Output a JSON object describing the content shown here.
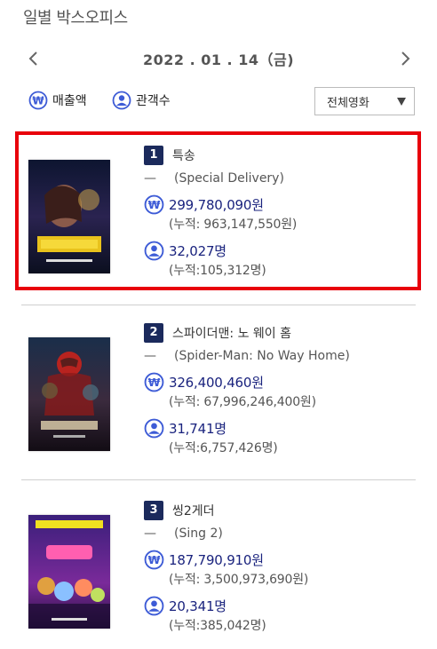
{
  "page": {
    "title": "일별 박스오피스"
  },
  "date_nav": {
    "date": "2022 . 01 . 14（금)",
    "prev_icon": "chevron-left-icon",
    "next_icon": "chevron-right-icon"
  },
  "toggles": {
    "sales_label": "매출액",
    "sales_icon": "won-icon",
    "audience_label": "관객수",
    "audience_icon": "person-icon"
  },
  "filter": {
    "selected": "전체영화"
  },
  "colors": {
    "accent": "#1b2a5c",
    "highlight": "#e8000b",
    "icon": "#3d5bd6"
  },
  "movies": [
    {
      "rank": "1",
      "title": "특송",
      "dash": "—",
      "original_title": "(Special Delivery)",
      "sales": "299,780,090원",
      "sales_cum": "(누적: 963,147,550원)",
      "audience": "32,027명",
      "audience_cum": "(누적:105,312명)",
      "highlighted": true
    },
    {
      "rank": "2",
      "title": "스파이더맨: 노 웨이 홈",
      "dash": "—",
      "original_title": "(Spider-Man: No Way Home)",
      "sales": "326,400,460원",
      "sales_cum": "(누적: 67,996,246,400원)",
      "audience": "31,741명",
      "audience_cum": "(누적:6,757,426명)",
      "highlighted": false
    },
    {
      "rank": "3",
      "title": "씽2게더",
      "dash": "—",
      "original_title": "(Sing 2)",
      "sales": "187,790,910원",
      "sales_cum": "(누적: 3,500,973,690원)",
      "audience": "20,341명",
      "audience_cum": "(누적:385,042명)",
      "highlighted": false
    }
  ]
}
